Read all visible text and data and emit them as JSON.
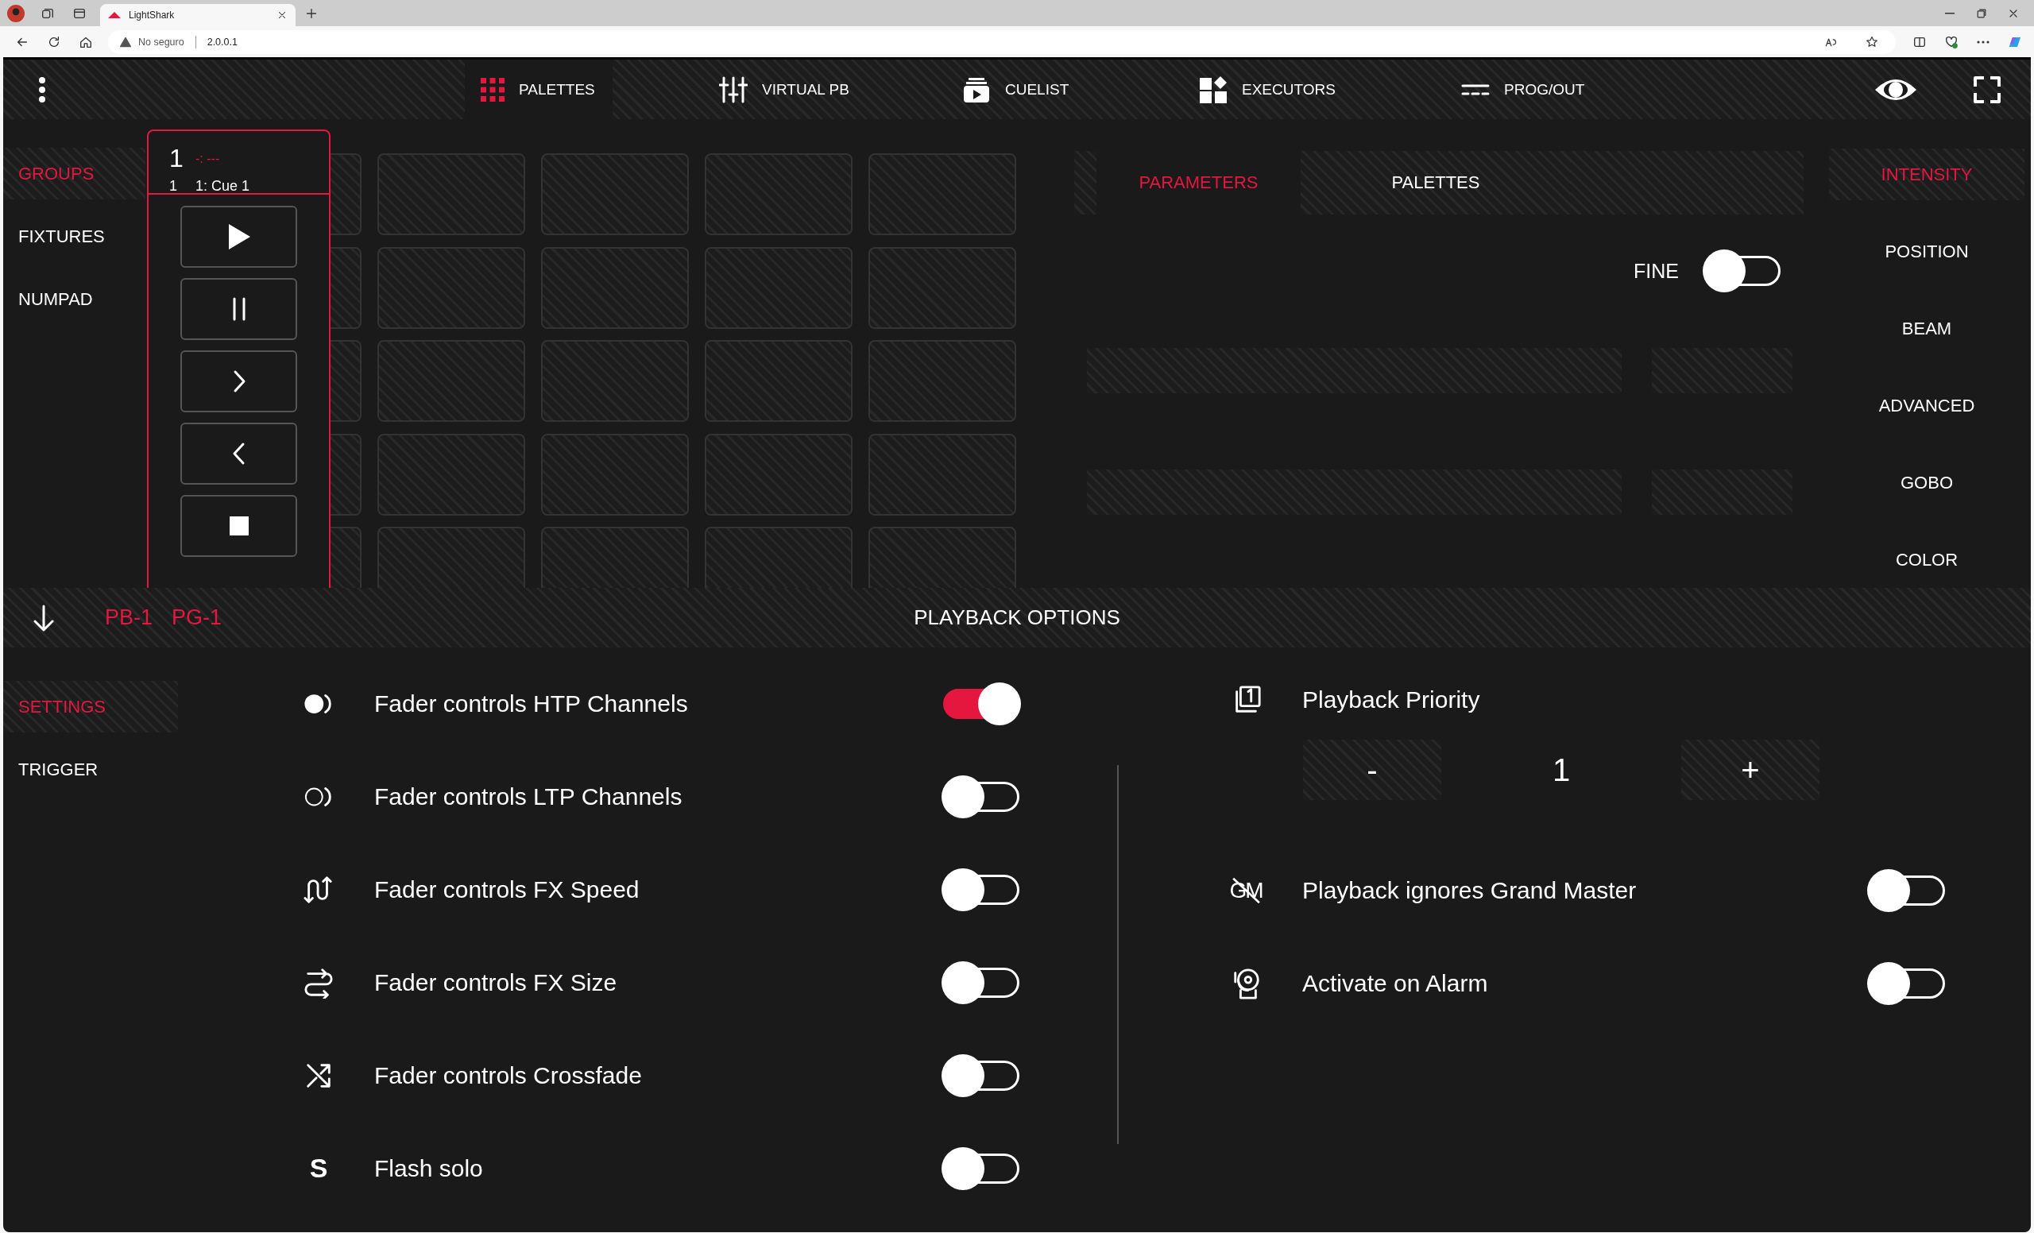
{
  "browser": {
    "tabs": [
      {
        "title": "LightShark",
        "selected": true
      }
    ],
    "address": {
      "security": "No seguro",
      "url": "2.0.0.1"
    }
  },
  "nav": {
    "items": [
      {
        "label": "PALETTES",
        "selected": true
      },
      {
        "label": "VIRTUAL PB",
        "selected": false
      },
      {
        "label": "CUELIST",
        "selected": false
      },
      {
        "label": "EXECUTORS",
        "selected": false
      },
      {
        "label": "PROG/OUT",
        "selected": false
      }
    ]
  },
  "upper": {
    "sidebar": [
      {
        "label": "GROUPS",
        "selected": true
      },
      {
        "label": "FIXTURES",
        "selected": false
      },
      {
        "label": "NUMPAD",
        "selected": false
      }
    ],
    "cue_panel": {
      "playback_number": "1",
      "time": "-: ---",
      "cue_number": "1",
      "cue_name": "1: Cue 1"
    },
    "tabs": [
      {
        "label": "PARAMETERS",
        "selected": true
      },
      {
        "label": "PALETTES",
        "selected": false
      }
    ],
    "fine": {
      "label": "FINE",
      "on": false
    },
    "categories": [
      {
        "label": "INTENSITY",
        "selected": true
      },
      {
        "label": "POSITION",
        "selected": false
      },
      {
        "label": "BEAM",
        "selected": false
      },
      {
        "label": "ADVANCED",
        "selected": false
      },
      {
        "label": "GOBO",
        "selected": false
      },
      {
        "label": "COLOR",
        "selected": false
      }
    ]
  },
  "playback_options": {
    "title": "PLAYBACK OPTIONS",
    "ids": [
      "PB-1",
      "PG-1"
    ],
    "sidebar": [
      {
        "label": "SETTINGS",
        "selected": true
      },
      {
        "label": "TRIGGER",
        "selected": false
      }
    ],
    "options": [
      {
        "label": "Fader controls HTP Channels",
        "on": true
      },
      {
        "label": "Fader controls LTP Channels",
        "on": false
      },
      {
        "label": "Fader controls FX Speed",
        "on": false
      },
      {
        "label": "Fader controls FX Size",
        "on": false
      },
      {
        "label": "Fader controls Crossfade",
        "on": false
      },
      {
        "label": "Flash solo",
        "on": false,
        "glyph": "S"
      }
    ],
    "priority": {
      "label": "Playback Priority",
      "decrement": "-",
      "value": "1",
      "increment": "+"
    },
    "right_options": [
      {
        "label": "Playback ignores Grand Master",
        "on": false,
        "glyph": "GM"
      },
      {
        "label": "Activate on Alarm",
        "on": false
      }
    ]
  }
}
